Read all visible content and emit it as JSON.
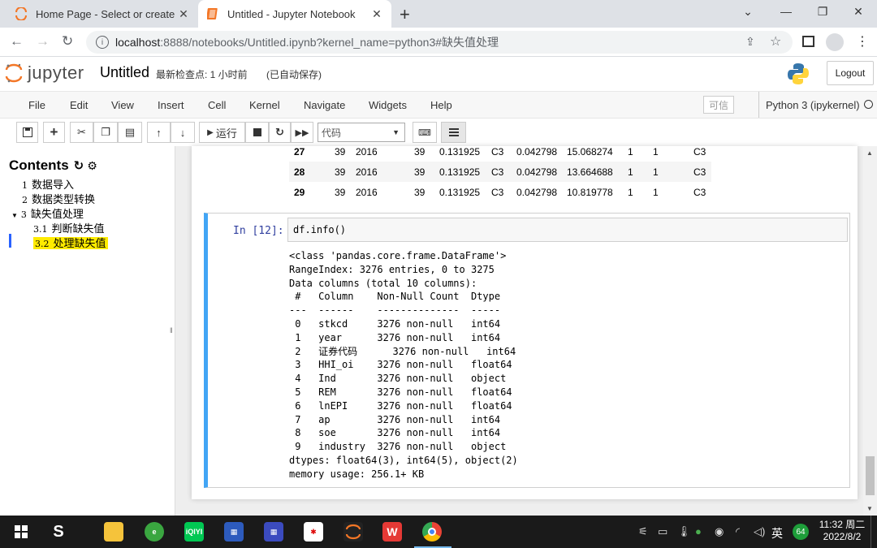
{
  "browser": {
    "tabs": [
      {
        "title": "Home Page - Select or create a",
        "active": false
      },
      {
        "title": "Untitled - Jupyter Notebook",
        "active": true
      }
    ],
    "new_tab": "+",
    "url_scheme": "localhost",
    "url_rest": ":8888/notebooks/Untitled.ipynb?kernel_name=python3#缺失值处理"
  },
  "header": {
    "logo_text": "jupyter",
    "notebook_name": "Untitled",
    "checkpoint": "最新检查点: 1 小时前",
    "autosave": "(已自动保存)",
    "logout": "Logout"
  },
  "menubar": {
    "items": [
      "File",
      "Edit",
      "View",
      "Insert",
      "Cell",
      "Kernel",
      "Navigate",
      "Widgets",
      "Help"
    ],
    "trusted": "可信",
    "kernel": "Python 3 (ipykernel)"
  },
  "toolbar": {
    "run_label": "运行",
    "cell_type": "代码"
  },
  "toc": {
    "title": "Contents",
    "items": [
      {
        "num": "1",
        "label": "数据导入",
        "level": 1
      },
      {
        "num": "2",
        "label": "数据类型转换",
        "level": 1
      },
      {
        "num": "3",
        "label": "缺失值处理",
        "level": 1
      },
      {
        "num": "3.1",
        "label": "判断缺失值",
        "level": 2
      },
      {
        "num": "3.2",
        "label": "处理缺失值",
        "level": 2
      }
    ]
  },
  "dataframe_rows": [
    {
      "idx": "27",
      "cells": [
        "39",
        "2016",
        "39",
        "0.131925",
        "C3",
        "0.042798",
        "15.068274",
        "1",
        "1",
        "C3"
      ]
    },
    {
      "idx": "28",
      "cells": [
        "39",
        "2016",
        "39",
        "0.131925",
        "C3",
        "0.042798",
        "13.664688",
        "1",
        "1",
        "C3"
      ]
    },
    {
      "idx": "29",
      "cells": [
        "39",
        "2016",
        "39",
        "0.131925",
        "C3",
        "0.042798",
        "10.819778",
        "1",
        "1",
        "C3"
      ]
    }
  ],
  "cell": {
    "prompt": "In  [12]:",
    "code": "df.info()",
    "output_lines": [
      "<class 'pandas.core.frame.DataFrame'>",
      "RangeIndex: 3276 entries, 0 to 3275",
      "Data columns (total 10 columns):",
      " #   Column    Non-Null Count  Dtype  ",
      "---  ------    --------------  -----  ",
      " 0   stkcd     3276 non-null   int64  ",
      " 1   year      3276 non-null   int64  ",
      " 2   证券代码      3276 non-null   int64  ",
      " 3   HHI_oi    3276 non-null   float64",
      " 4   Ind       3276 non-null   object ",
      " 5   REM       3276 non-null   float64",
      " 6   lnEPI     3276 non-null   float64",
      " 7   ap        3276 non-null   int64  ",
      " 8   soe       3276 non-null   int64  ",
      " 9   industry  3276 non-null   object ",
      "dtypes: float64(3), int64(5), object(2)",
      "memory usage: 256.1+ KB"
    ]
  },
  "taskbar": {
    "ime": "英",
    "badge": "64",
    "time": "11:32 周二",
    "date": "2022/8/2"
  }
}
